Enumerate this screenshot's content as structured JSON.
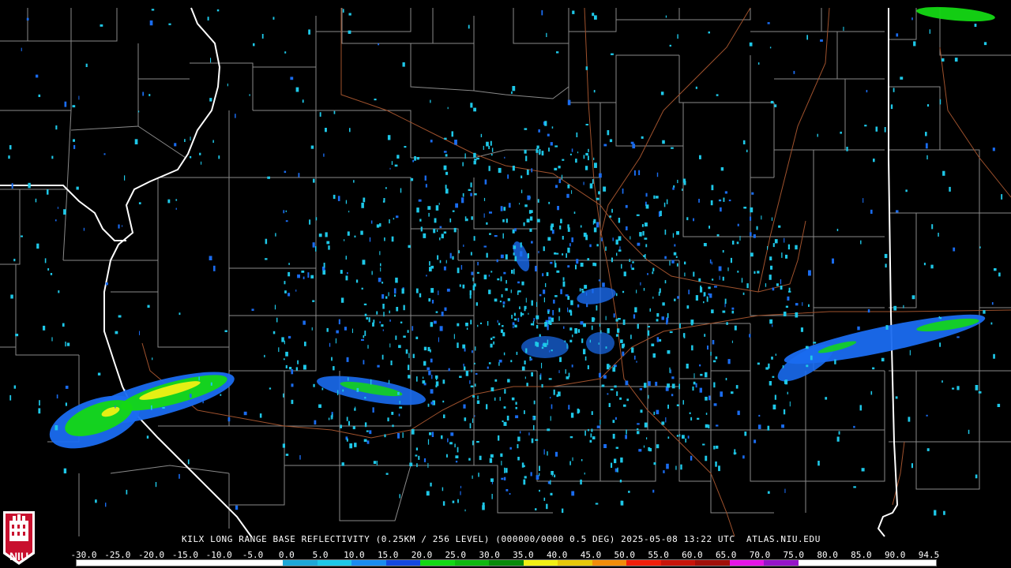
{
  "caption": {
    "text": "KILX LONG RANGE BASE REFLECTIVITY (0.25KM / 256 LEVEL) (000000/0000 0.5 DEG) 2025-05-08 13:22 UTC  ATLAS.NIU.EDU"
  },
  "legend": {
    "labels": [
      "-30.0",
      "-25.0",
      "-20.0",
      "-15.0",
      "-10.0",
      "-5.0",
      "0.0",
      "5.0",
      "10.0",
      "15.0",
      "20.0",
      "25.0",
      "30.0",
      "35.0",
      "40.0",
      "45.0",
      "50.0",
      "55.0",
      "60.0",
      "65.0",
      "70.0",
      "75.0",
      "80.0",
      "85.0",
      "90.0",
      "94.5"
    ],
    "colors": [
      "#ffffff",
      "#ffffff",
      "#ffffff",
      "#ffffff",
      "#ffffff",
      "#ffffff",
      "#1ea8d8",
      "#1ec8e8",
      "#1a8cf0",
      "#1448e0",
      "#14d814",
      "#10b810",
      "#0a8a0a",
      "#f0f014",
      "#e6c80a",
      "#f08c0a",
      "#f01e0a",
      "#c8140a",
      "#a0100a",
      "#e614e6",
      "#9614c8",
      "#ffffff",
      "#ffffff",
      "#ffffff",
      "#ffffff"
    ]
  },
  "logo": {
    "text": "NIU",
    "color": "#c8102e"
  },
  "map_colors": {
    "county": "#8a8a8a",
    "state": "#ffffff",
    "highway": "#a0522d",
    "echo_light": "#1ec8e8",
    "echo_med": "#1a6cf0",
    "echo_green": "#14d814",
    "echo_yellow": "#f0f014"
  }
}
